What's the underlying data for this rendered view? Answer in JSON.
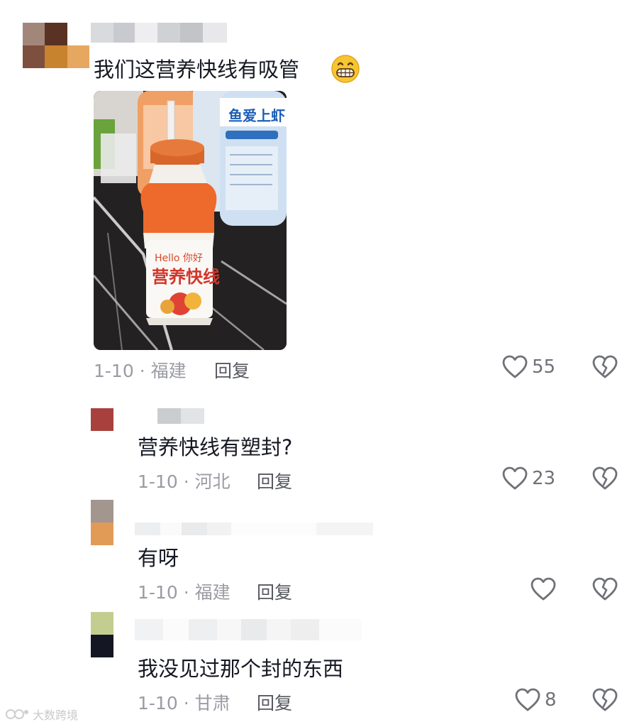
{
  "colors": {
    "text": "#161823",
    "meta": "#9a9ca3",
    "reply": "#56585f",
    "icon": "#6f7178"
  },
  "comments": [
    {
      "text": "我们这营养快线有吸管",
      "emoji": "grinning-face-icon",
      "date": "1-10",
      "location": "福建",
      "reply_label": "回复",
      "likes": "55"
    },
    {
      "text": "营养快线有塑封?",
      "date": "1-10",
      "location": "河北",
      "reply_label": "回复",
      "likes": "23"
    },
    {
      "text": "有呀",
      "date": "1-10",
      "location": "福建",
      "reply_label": "回复",
      "likes": ""
    },
    {
      "text": "我没见过那个封的东西",
      "date": "1-10",
      "location": "甘肃",
      "reply_label": "回复",
      "likes": "8"
    }
  ],
  "photo": {
    "label_brand": "Hello 你好",
    "label_product": "营养快线",
    "background_bottle_text": "鱼爱上虾"
  },
  "watermark": "大数跨境"
}
